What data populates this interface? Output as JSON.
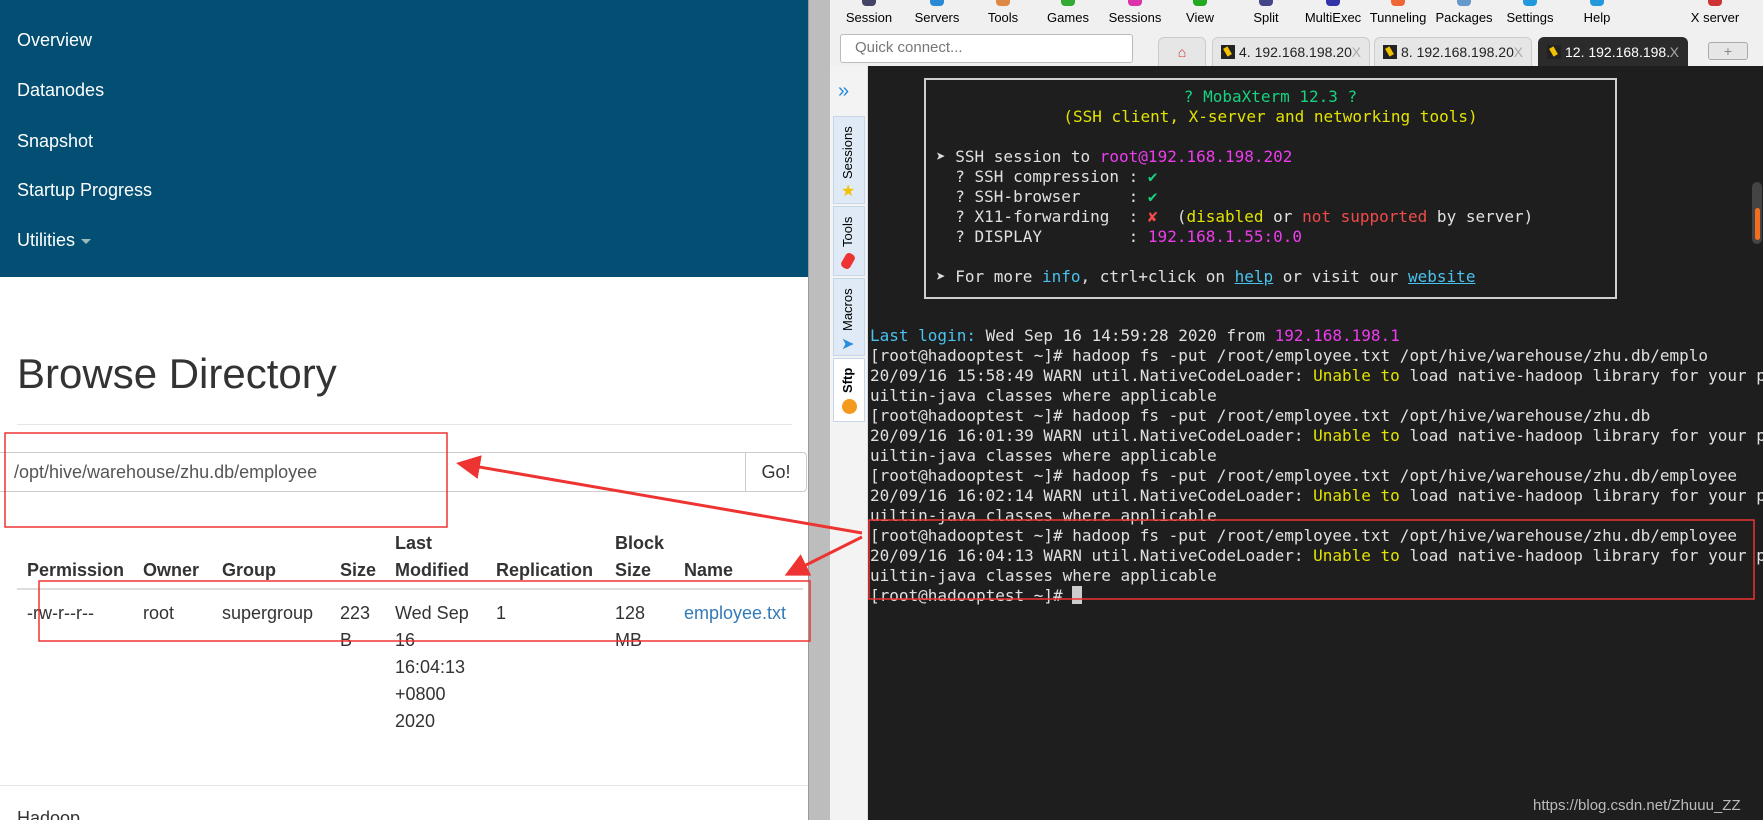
{
  "hdfs": {
    "nav": [
      "Overview",
      "Datanodes",
      "Snapshot",
      "Startup Progress",
      "Utilities"
    ],
    "title": "Browse Directory",
    "path_value": "/opt/hive/warehouse/zhu.db/employee",
    "go_label": "Go!",
    "columns": [
      [
        "",
        "Permission"
      ],
      [
        "",
        "Owner"
      ],
      [
        "",
        "Group"
      ],
      [
        "",
        "Size"
      ],
      [
        "Last",
        "Modified"
      ],
      [
        "",
        "Replication"
      ],
      [
        "Block",
        "Size"
      ],
      [
        "",
        "Name"
      ]
    ],
    "row": {
      "permission": "-rw-r--r--",
      "owner": "root",
      "group": "supergroup",
      "size": [
        "223",
        "B"
      ],
      "modified": [
        "Wed Sep",
        "16",
        "16:04:13",
        "+0800",
        "2020"
      ],
      "replication": "1",
      "block_size": [
        "128",
        "MB"
      ],
      "name": "employee.txt"
    },
    "footer": "Hadoop",
    "link_color": "#337ab7",
    "nav_color": "#034f73"
  },
  "mobaxterm": {
    "toolbar": [
      "Session",
      "Servers",
      "Tools",
      "Games",
      "Sessions",
      "View",
      "Split",
      "MultiExec",
      "Tunneling",
      "Packages",
      "Settings",
      "Help",
      "X server"
    ],
    "quick_connect_placeholder": "Quick connect...",
    "tabs": [
      "4. 192.168.198.20",
      "8. 192.168.198.20",
      "12. 192.168.198."
    ],
    "tab_close": "X",
    "sidebar": [
      "Sessions",
      "Tools",
      "Macros",
      "Sftp"
    ],
    "banner": {
      "title": "? MobaXterm 12.3 ?",
      "subtitle": "(SSH client, X-server and networking tools)",
      "ssh_prefix": "➤ SSH session to ",
      "ssh_user": "root",
      "ssh_host": "@192.168.198.202",
      "compression": "  ? SSH compression : ",
      "browser": "  ? SSH-browser     : ",
      "x11": "  ? X11-forwarding  : ",
      "display": "  ? DISPLAY         : ",
      "check": "✔",
      "cross": "✘",
      "open_paren": "  (",
      "disabled": "disabled",
      " or ": " or ",
      "not_supported": "not supported",
      "by_server": " by server)",
      "display_value": "192.168.1.55:0.0",
      "more_prefix": "➤ For more ",
      "info": "info",
      "ctrl": ", ctrl+click on ",
      "help": "help",
      "visit": " or visit our ",
      "website": "website"
    },
    "terminal": {
      "last_login_label": "Last login:",
      "last_login_text": " Wed Sep 16 14:59:28 2020 from ",
      "last_login_ip": "192.168.198.1",
      "cmds": [
        "[root@hadooptest ~]# hadoop fs -put /root/employee.txt /opt/hive/warehouse/zhu.db/emplo",
        "[root@hadooptest ~]# hadoop fs -put /root/employee.txt /opt/hive/warehouse/zhu.db",
        "[root@hadooptest ~]# hadoop fs -put /root/employee.txt /opt/hive/warehouse/zhu.db/employee",
        "[root@hadooptest ~]# hadoop fs -put /root/employee.txt /opt/hive/warehouse/zhu.db/employee"
      ],
      "warn_prefix": [
        "20/09/16 15:58:49 WARN util.NativeCodeLoader: ",
        "20/09/16 16:01:39 WARN util.NativeCodeLoader: ",
        "20/09/16 16:02:14 WARN util.NativeCodeLoader: ",
        "20/09/16 16:04:13 WARN util.NativeCodeLoader: "
      ],
      "warn_hl": "Unable to",
      "warn_rest": " load native-hadoop library for your platform... using b",
      "warn_cont": "uiltin-java classes where applicable",
      "prompt": "[root@hadooptest ~]# "
    },
    "watermark": "https://blog.csdn.net/Zhuuu_ZZ"
  },
  "annotation_color": "#ee3333"
}
